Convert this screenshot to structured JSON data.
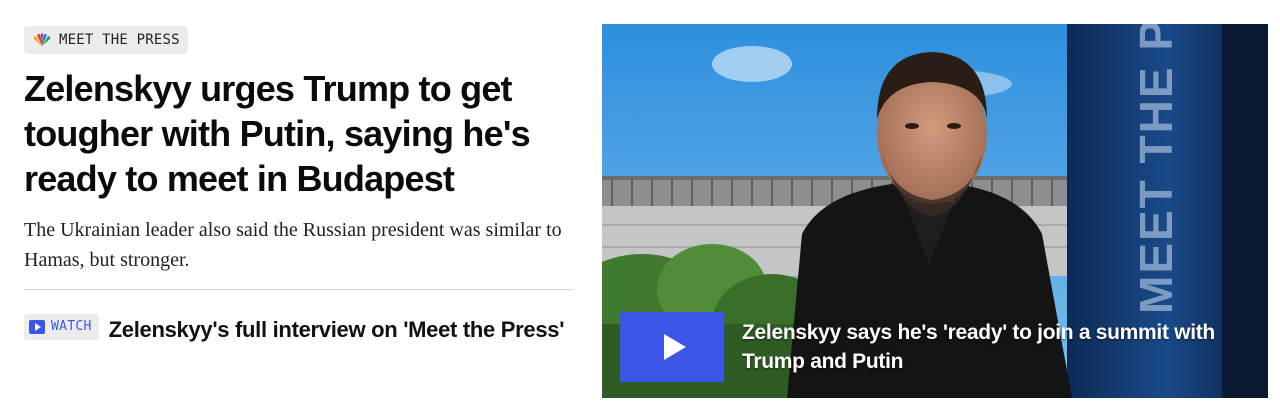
{
  "section_badge": {
    "label": "MEET THE PRESS",
    "icon": "nbc-peacock-icon"
  },
  "article": {
    "headline": "Zelenskyy urges Trump to get tougher with Putin, saying he's ready to meet in Budapest",
    "dek": "The Ukrainian leader also said the Russian president was similar to Hamas, but stronger."
  },
  "related": {
    "watch_label": "WATCH",
    "title": "Zelenskyy's full interview on 'Meet the Press'"
  },
  "video": {
    "caption": "Zelenskyy says he's 'ready' to join a summit with Trump and Putin",
    "play_icon": "play-icon",
    "backdrop_text": "MEET THE PR"
  },
  "colors": {
    "accent": "#3b55e6",
    "badge_bg": "#ececec"
  }
}
